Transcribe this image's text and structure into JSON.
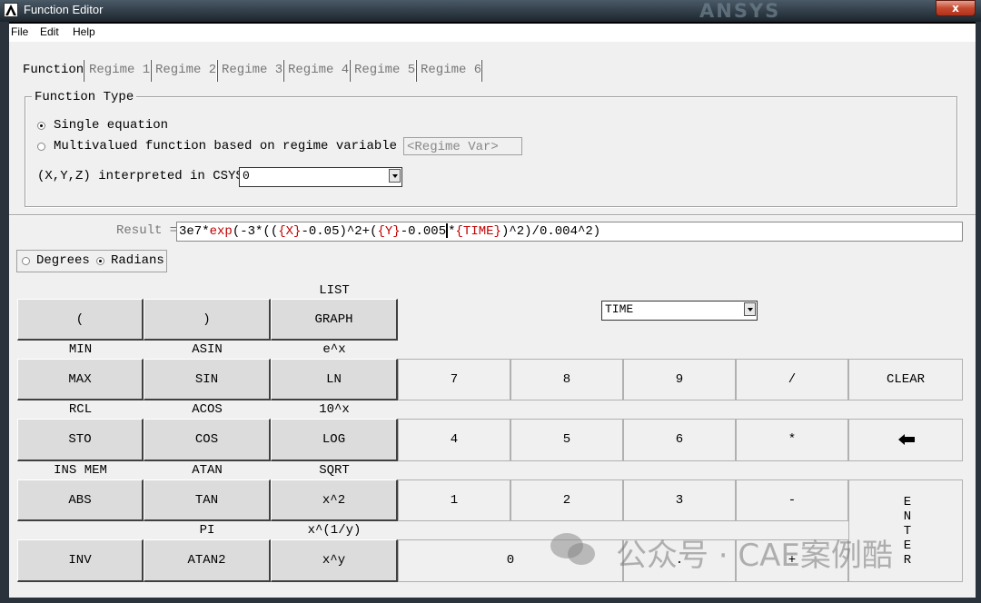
{
  "window": {
    "title": "Function Editor",
    "brand": "ANSYS",
    "close_label": "x"
  },
  "menu": [
    "File",
    "Edit",
    "Help"
  ],
  "tabs": [
    {
      "label": "Function",
      "active": true
    },
    {
      "label": "Regime 1",
      "active": false
    },
    {
      "label": "Regime 2",
      "active": false
    },
    {
      "label": "Regime 3",
      "active": false
    },
    {
      "label": "Regime 4",
      "active": false
    },
    {
      "label": "Regime 5",
      "active": false
    },
    {
      "label": "Regime 6",
      "active": false
    }
  ],
  "function_type": {
    "group_label": "Function Type",
    "single": {
      "label": "Single equation",
      "selected": true
    },
    "multi": {
      "label": "Multivalued function based on regime variable",
      "selected": false
    },
    "regime_var_placeholder": "<Regime Var>",
    "csys_label": "(X,Y,Z) interpreted in CSYS:",
    "csys_value": "0"
  },
  "result": {
    "label": "Result =",
    "expression_parts": [
      {
        "t": "3e7*",
        "c": "k"
      },
      {
        "t": "exp",
        "c": "r"
      },
      {
        "t": "(-3*((",
        "c": "k"
      },
      {
        "t": "{X}",
        "c": "r"
      },
      {
        "t": "-0.05)^2+(",
        "c": "k"
      },
      {
        "t": "{Y}",
        "c": "r"
      },
      {
        "t": "-0.005",
        "c": "k"
      },
      {
        "t": "|",
        "c": "caret"
      },
      {
        "t": "*",
        "c": "k"
      },
      {
        "t": "{TIME}",
        "c": "r"
      },
      {
        "t": ")^2)/0.004^2)",
        "c": "k"
      }
    ]
  },
  "angle": {
    "degrees": "Degrees",
    "radians": "Radians",
    "selected": "Radians"
  },
  "variable_select": "TIME",
  "keypad": {
    "top_labels": [
      "LIST",
      "MIN",
      "ASIN",
      "e^x",
      "RCL",
      "ACOS",
      "10^x",
      "INS MEM",
      "ATAN",
      "SQRT",
      "PI",
      "x^(1/y)"
    ],
    "func_buttons": [
      "(",
      ")",
      "GRAPH",
      "MAX",
      "SIN",
      "LN",
      "STO",
      "COS",
      "LOG",
      "ABS",
      "TAN",
      "x^2",
      "INV",
      "ATAN2",
      "x^y"
    ],
    "num_buttons": [
      "7",
      "8",
      "9",
      "/",
      "CLEAR",
      "4",
      "5",
      "6",
      "*",
      "1",
      "2",
      "3",
      "-",
      "0",
      ".",
      "+"
    ],
    "enter_label": "ENTER"
  },
  "watermark": "公众号 · CAE案例酷",
  "colors": {
    "accent_red": "#c00000",
    "face": "#f0f0f0",
    "button": "#dcdcdc"
  }
}
